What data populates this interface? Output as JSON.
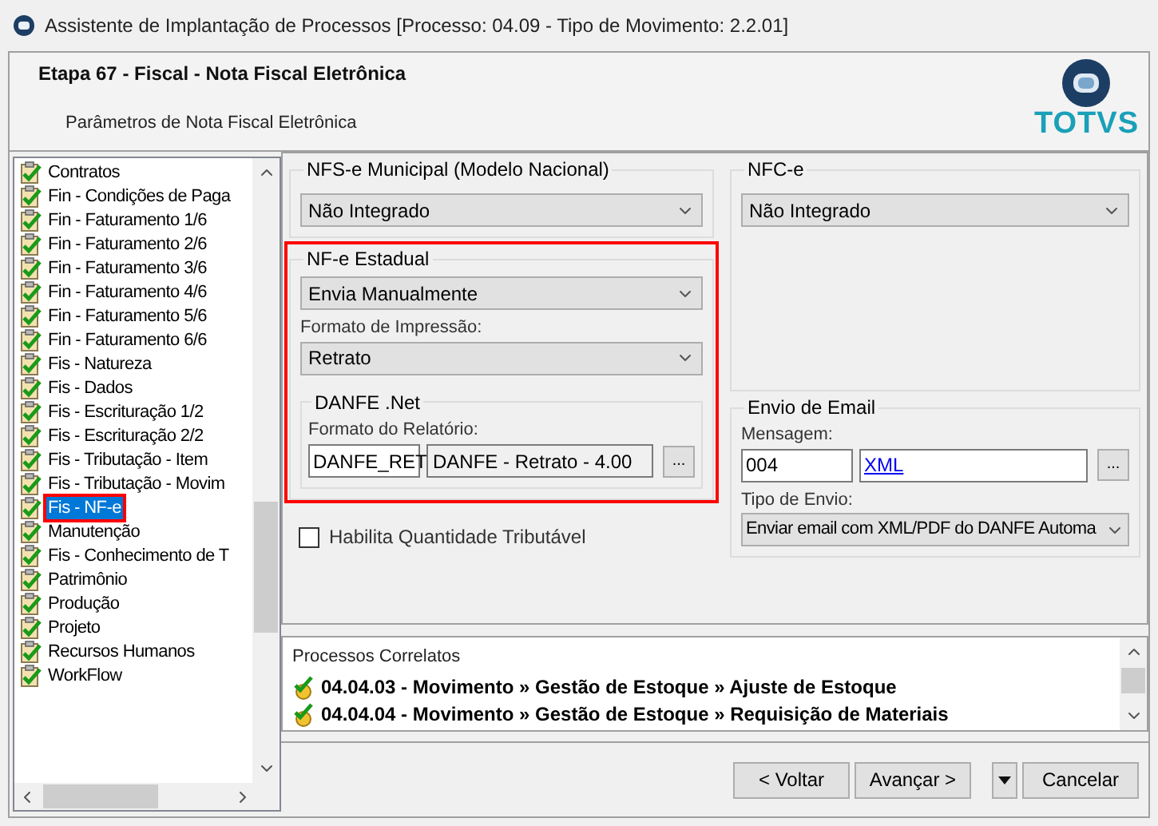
{
  "window": {
    "title": "Assistente de Implantação de Processos [Processo: 04.09 - Tipo de Movimento: 2.2.01]"
  },
  "header": {
    "title": "Etapa 67 - Fiscal - Nota Fiscal Eletrônica",
    "subtitle": "Parâmetros de Nota Fiscal Eletrônica",
    "logo": "TOTVS"
  },
  "sidebar": {
    "items": [
      {
        "label": "Contratos",
        "selected": false
      },
      {
        "label": "Fin - Condições de Paga",
        "selected": false
      },
      {
        "label": "Fin - Faturamento 1/6",
        "selected": false
      },
      {
        "label": "Fin - Faturamento 2/6",
        "selected": false
      },
      {
        "label": "Fin - Faturamento 3/6",
        "selected": false
      },
      {
        "label": "Fin - Faturamento 4/6",
        "selected": false
      },
      {
        "label": "Fin - Faturamento 5/6",
        "selected": false
      },
      {
        "label": "Fin - Faturamento 6/6",
        "selected": false
      },
      {
        "label": "Fis - Natureza",
        "selected": false
      },
      {
        "label": "Fis - Dados",
        "selected": false
      },
      {
        "label": "Fis - Escrituração 1/2",
        "selected": false
      },
      {
        "label": "Fis - Escrituração 2/2",
        "selected": false
      },
      {
        "label": "Fis - Tributação - Item",
        "selected": false
      },
      {
        "label": "Fis - Tributação - Movim",
        "selected": false
      },
      {
        "label": "Fis - NF-e",
        "selected": true
      },
      {
        "label": "Manutenção",
        "selected": false
      },
      {
        "label": "Fis - Conhecimento de T",
        "selected": false
      },
      {
        "label": "Patrimônio",
        "selected": false
      },
      {
        "label": "Produção",
        "selected": false
      },
      {
        "label": "Projeto",
        "selected": false
      },
      {
        "label": "Recursos Humanos",
        "selected": false
      },
      {
        "label": "WorkFlow",
        "selected": false
      }
    ]
  },
  "nfse": {
    "legend": "NFS-e Municipal (Modelo Nacional)",
    "value": "Não Integrado"
  },
  "nfe": {
    "legend": "NF-e Estadual",
    "value": "Envia Manualmente",
    "print_label": "Formato de Impressão:",
    "print_value": "Retrato",
    "danfe": {
      "legend": "DANFE .Net",
      "format_label": "Formato do Relatório:",
      "code": "DANFE_RET",
      "description": "DANFE - Retrato - 4.00",
      "browse": "..."
    }
  },
  "checkbox": {
    "label": "Habilita Quantidade Tributável",
    "checked": false
  },
  "nfce": {
    "legend": "NFC-e",
    "value": "Não Integrado"
  },
  "email": {
    "legend": "Envio de Email",
    "message_label": "Mensagem:",
    "code": "004",
    "link": "XML",
    "browse": "...",
    "send_type_label": "Tipo de Envio:",
    "send_type": "Enviar email com XML/PDF do DANFE Automa"
  },
  "correlated": {
    "title": "Processos Correlatos",
    "items": [
      "04.04.03 - Movimento » Gestão de Estoque » Ajuste de Estoque",
      "04.04.04 - Movimento » Gestão de Estoque » Requisição de Materiais"
    ]
  },
  "buttons": {
    "back": "< Voltar",
    "next": "Avançar >",
    "cancel": "Cancelar"
  }
}
